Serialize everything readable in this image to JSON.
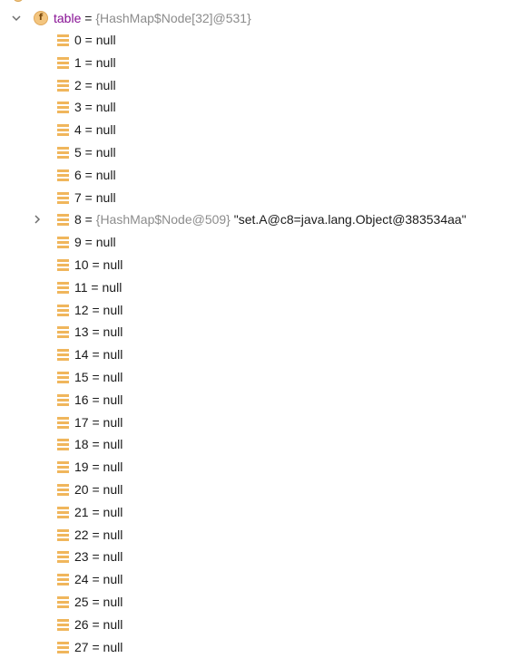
{
  "root": {
    "badge": "f",
    "name": "table",
    "equals": " = ",
    "type": "{HashMap$Node[32]@531}"
  },
  "children": [
    {
      "index": "0",
      "equals": " = ",
      "value": "null"
    },
    {
      "index": "1",
      "equals": " = ",
      "value": "null"
    },
    {
      "index": "2",
      "equals": " = ",
      "value": "null"
    },
    {
      "index": "3",
      "equals": " = ",
      "value": "null"
    },
    {
      "index": "4",
      "equals": " = ",
      "value": "null"
    },
    {
      "index": "5",
      "equals": " = ",
      "value": "null"
    },
    {
      "index": "6",
      "equals": " = ",
      "value": "null"
    },
    {
      "index": "7",
      "equals": " = ",
      "value": "null"
    },
    {
      "index": "8",
      "equals": " = ",
      "type": "{HashMap$Node@509}",
      "value": " \"set.A@c8=java.lang.Object@383534aa\"",
      "expandable": true
    },
    {
      "index": "9",
      "equals": " = ",
      "value": "null"
    },
    {
      "index": "10",
      "equals": " = ",
      "value": "null"
    },
    {
      "index": "11",
      "equals": " = ",
      "value": "null"
    },
    {
      "index": "12",
      "equals": " = ",
      "value": "null"
    },
    {
      "index": "13",
      "equals": " = ",
      "value": "null"
    },
    {
      "index": "14",
      "equals": " = ",
      "value": "null"
    },
    {
      "index": "15",
      "equals": " = ",
      "value": "null"
    },
    {
      "index": "16",
      "equals": " = ",
      "value": "null"
    },
    {
      "index": "17",
      "equals": " = ",
      "value": "null"
    },
    {
      "index": "18",
      "equals": " = ",
      "value": "null"
    },
    {
      "index": "19",
      "equals": " = ",
      "value": "null"
    },
    {
      "index": "20",
      "equals": " = ",
      "value": "null"
    },
    {
      "index": "21",
      "equals": " = ",
      "value": "null"
    },
    {
      "index": "22",
      "equals": " = ",
      "value": "null"
    },
    {
      "index": "23",
      "equals": " = ",
      "value": "null"
    },
    {
      "index": "24",
      "equals": " = ",
      "value": "null"
    },
    {
      "index": "25",
      "equals": " = ",
      "value": "null"
    },
    {
      "index": "26",
      "equals": " = ",
      "value": "null"
    },
    {
      "index": "27",
      "equals": " = ",
      "value": "null"
    }
  ],
  "icons": {
    "expanded": "chevron-down-icon",
    "collapsed": "chevron-right-icon",
    "field": "field-icon",
    "array_element": "array-element-icon"
  },
  "colors": {
    "field_name": "#871094",
    "type_text": "#8c8c8c",
    "icon_orange": "#f0b65c"
  }
}
